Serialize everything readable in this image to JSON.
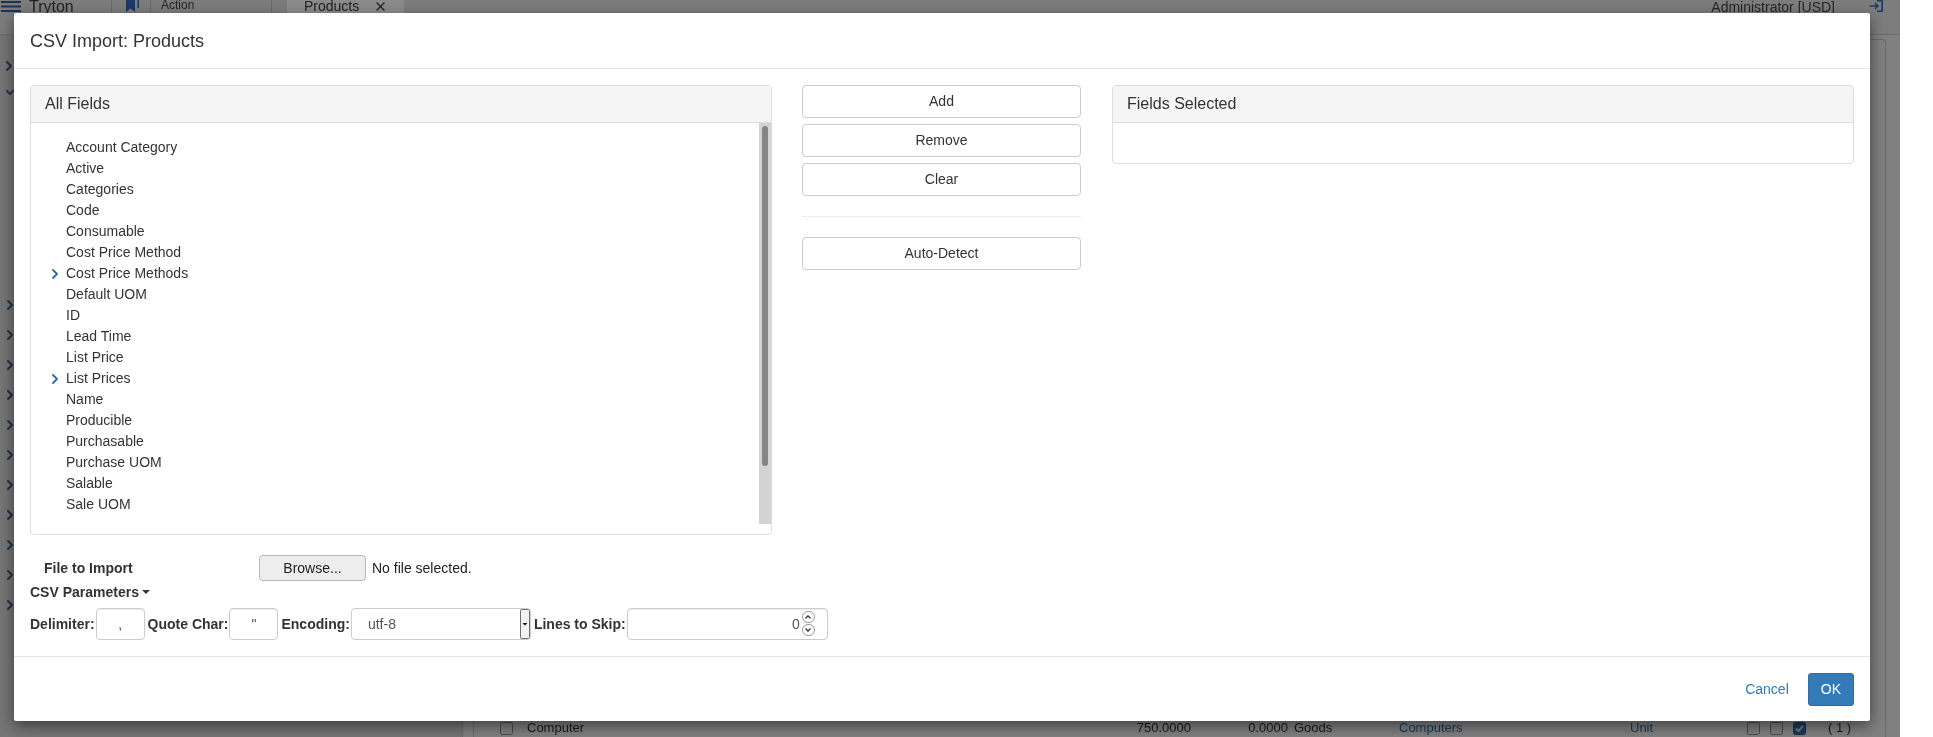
{
  "app_background": {
    "navbar": {
      "brand": "Tryton",
      "action_label": "Action",
      "tabs": [
        {
          "label": "Products",
          "selected": true
        }
      ],
      "user": "Administrator [USD]"
    },
    "sidebar": {
      "nodes": [
        {
          "expanded": false
        },
        {
          "expanded": true,
          "children": [
            {
              "expanded": false
            },
            {
              "expanded": false
            },
            {
              "expanded": false
            },
            {
              "expanded": false
            },
            {
              "expanded": false
            },
            {
              "expanded": false
            },
            {
              "expanded": false
            },
            {
              "expanded": false
            },
            {
              "expanded": false
            },
            {
              "expanded": false
            },
            {
              "expanded": false
            }
          ]
        }
      ]
    },
    "table_row": {
      "selected": false,
      "cells": [
        {
          "kind": "text",
          "text": "Computer"
        },
        {
          "kind": "number",
          "text": "750.0000"
        },
        {
          "kind": "number",
          "text": "0.0000"
        },
        {
          "kind": "text",
          "text": "Goods"
        },
        {
          "kind": "link",
          "text": "Computers"
        },
        {
          "kind": "link",
          "text": "Unit"
        }
      ],
      "flags": [
        {
          "checked": false
        },
        {
          "checked": false
        },
        {
          "checked": true
        }
      ],
      "count": "( 1 )"
    }
  },
  "dialog": {
    "title": "CSV Import: Products",
    "all_fields": {
      "title": "All Fields",
      "items": [
        {
          "label": "Account Category"
        },
        {
          "label": "Active"
        },
        {
          "label": "Categories"
        },
        {
          "label": "Code"
        },
        {
          "label": "Consumable"
        },
        {
          "label": "Cost Price Method"
        },
        {
          "label": "Cost Price Methods",
          "expanded": false
        },
        {
          "label": "Default UOM"
        },
        {
          "label": "ID"
        },
        {
          "label": "Lead Time"
        },
        {
          "label": "List Price"
        },
        {
          "label": "List Prices",
          "expanded": false
        },
        {
          "label": "Name"
        },
        {
          "label": "Producible"
        },
        {
          "label": "Purchasable"
        },
        {
          "label": "Purchase UOM"
        },
        {
          "label": "Salable"
        },
        {
          "label": "Sale UOM"
        }
      ]
    },
    "actions": [
      "Add",
      "Remove",
      "Clear"
    ],
    "auto_detect": "Auto-Detect",
    "fields_selected": {
      "title": "Fields Selected"
    },
    "file_to_import": {
      "label": "File to Import",
      "button": "Browse...",
      "status": "No file selected."
    },
    "csv_parameters": {
      "label": "CSV Parameters",
      "expanded": true,
      "fields": [
        {
          "kind": "text",
          "label": "Delimiter:",
          "value": ","
        },
        {
          "kind": "text",
          "label": "Quote Char:",
          "value": "\""
        },
        {
          "kind": "select",
          "label": "Encoding:",
          "value": "utf-8"
        },
        {
          "kind": "number",
          "label": "Lines to Skip:",
          "value": "0"
        }
      ]
    },
    "footer": {
      "cancel": "Cancel",
      "ok": "OK"
    }
  }
}
